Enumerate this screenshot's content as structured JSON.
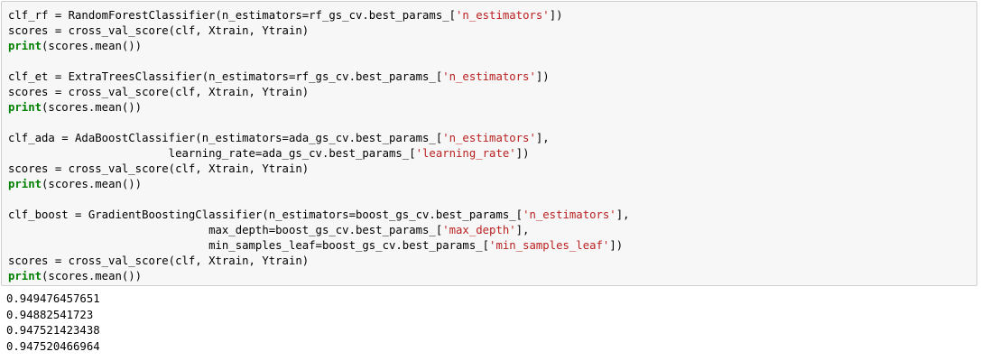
{
  "input_cell": {
    "lines": [
      {
        "a": "clf_rf = RandomForestClassifier(n_estimators=rf_gs_cv.best_params_[",
        "s": "'n_estimators'",
        "b": "])"
      },
      {
        "a": "scores = cross_val_score(clf, Xtrain, Ytrain)"
      },
      {
        "k": "print",
        "a": "(scores.mean())"
      },
      {
        "a": ""
      },
      {
        "a": "clf_et = ExtraTreesClassifier(n_estimators=rf_gs_cv.best_params_[",
        "s": "'n_estimators'",
        "b": "])"
      },
      {
        "a": "scores = cross_val_score(clf, Xtrain, Ytrain)"
      },
      {
        "k": "print",
        "a": "(scores.mean())"
      },
      {
        "a": ""
      },
      {
        "a": "clf_ada = AdaBoostClassifier(n_estimators=ada_gs_cv.best_params_[",
        "s": "'n_estimators'",
        "b": "],"
      },
      {
        "a": "                        learning_rate=ada_gs_cv.best_params_[",
        "s": "'learning_rate'",
        "b": "])"
      },
      {
        "a": "scores = cross_val_score(clf, Xtrain, Ytrain)"
      },
      {
        "k": "print",
        "a": "(scores.mean())"
      },
      {
        "a": ""
      },
      {
        "a": "clf_boost = GradientBoostingClassifier(n_estimators=boost_gs_cv.best_params_[",
        "s": "'n_estimators'",
        "b": "],"
      },
      {
        "a": "                              max_depth=boost_gs_cv.best_params_[",
        "s": "'max_depth'",
        "b": "],"
      },
      {
        "a": "                              min_samples_leaf=boost_gs_cv.best_params_[",
        "s": "'min_samples_leaf'",
        "b": "])"
      },
      {
        "a": "scores = cross_val_score(clf, Xtrain, Ytrain)"
      },
      {
        "k": "print",
        "a": "(scores.mean())"
      }
    ]
  },
  "output_cell": {
    "lines": [
      "0.949476457651",
      "0.94882541723",
      "0.947521423438",
      "0.947520466964"
    ]
  },
  "colors": {
    "keyword": "#008000",
    "string": "#ba2121",
    "cell_background": "#f7f7f7",
    "cell_border": "#cfcfcf"
  }
}
